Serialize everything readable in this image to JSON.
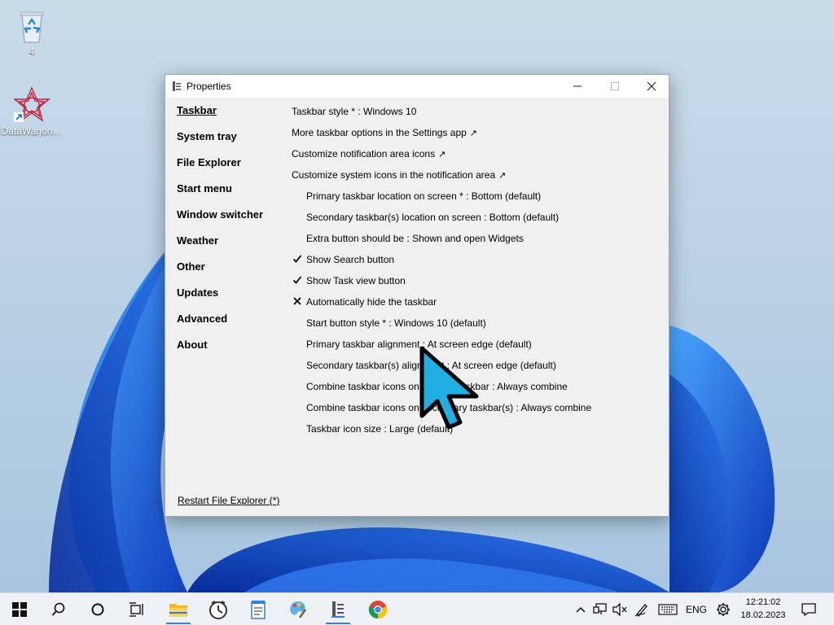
{
  "desktop": {
    "icons": [
      {
        "label": "4",
        "icon": "recycle-bin-icon"
      },
      {
        "label": "DataWagon…",
        "icon": "datawagon-shortcut-icon"
      }
    ]
  },
  "window": {
    "title": "Properties",
    "nav": [
      {
        "label": "Taskbar",
        "active": true
      },
      {
        "label": "System tray"
      },
      {
        "label": "File Explorer"
      },
      {
        "label": "Start menu"
      },
      {
        "label": "Window switcher"
      },
      {
        "label": "Weather"
      },
      {
        "label": "Other"
      },
      {
        "label": "Updates"
      },
      {
        "label": "Advanced"
      },
      {
        "label": "About"
      }
    ],
    "options": [
      {
        "text": "Taskbar style * : Windows 10"
      },
      {
        "text": "More taskbar options in the Settings app",
        "ext": "↗"
      },
      {
        "text": "Customize notification area icons",
        "ext": "↗"
      },
      {
        "text": "Customize system icons in the notification area",
        "ext": "↗"
      },
      {
        "text": "Primary taskbar location on screen * : Bottom (default)"
      },
      {
        "text": "Secondary taskbar(s) location on screen : Bottom (default)"
      },
      {
        "text": "Extra button should be : Shown and open Widgets"
      },
      {
        "text": "Show Search button",
        "state": "checked"
      },
      {
        "text": "Show Task view button",
        "state": "checked"
      },
      {
        "text": "Automatically hide the taskbar",
        "state": "crossed"
      },
      {
        "text": "Start button style * : Windows 10 (default)"
      },
      {
        "text": "Primary taskbar alignment : At screen edge (default)"
      },
      {
        "text": "Secondary taskbar(s) alignment : At screen edge (default)"
      },
      {
        "text": "Combine taskbar icons on primary taskbar : Always combine"
      },
      {
        "text": "Combine taskbar icons on secondary taskbar(s) : Always combine"
      },
      {
        "text": "Taskbar icon size : Large (default)"
      }
    ],
    "restart_label": "Restart File Explorer (*)"
  },
  "taskbar": {
    "apps": [
      {
        "icon": "windows-start-icon"
      },
      {
        "icon": "search-icon"
      },
      {
        "icon": "cortana-circle-icon"
      },
      {
        "icon": "task-view-icon"
      },
      {
        "icon": "file-explorer-icon",
        "running": true
      },
      {
        "icon": "clock-app-icon"
      },
      {
        "icon": "notepad-icon"
      },
      {
        "icon": "paint-icon"
      },
      {
        "icon": "properties-app-icon",
        "running": true
      },
      {
        "icon": "chrome-icon"
      }
    ],
    "tray": {
      "language": "ENG",
      "time": "12:21:02",
      "date": "18.02.2023"
    }
  },
  "colors": {
    "accent": "#3c7fd6",
    "cursor_fill": "#20aee3",
    "wallpaper_bloom": "#1a56d6"
  }
}
